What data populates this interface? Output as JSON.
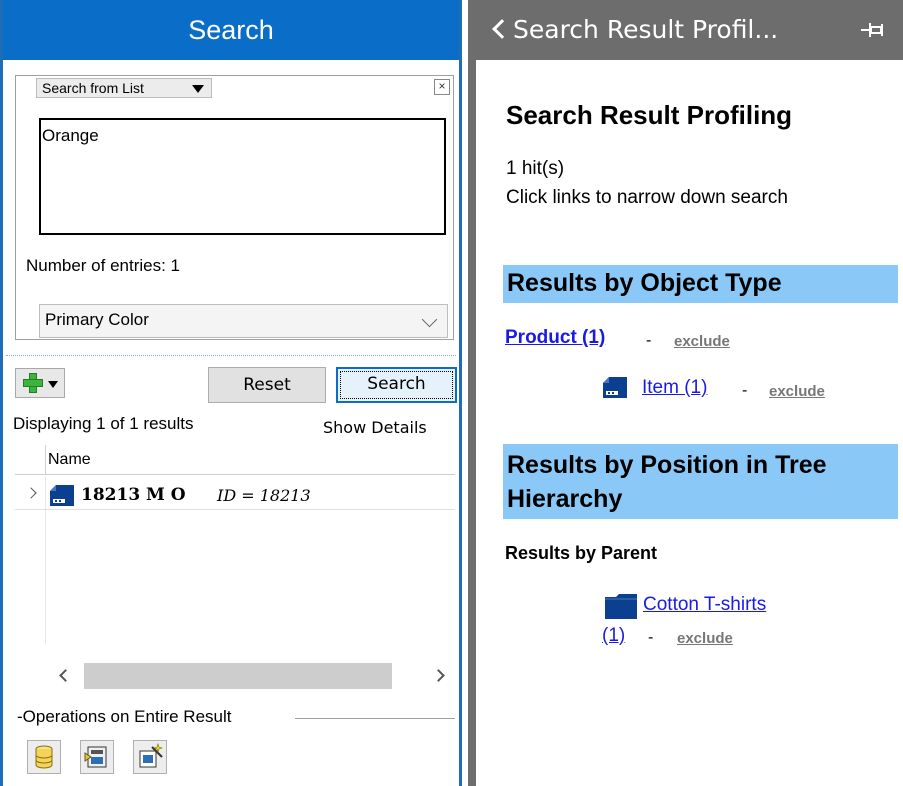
{
  "left_panel": {
    "title": "Search",
    "search_mode": "Search from List",
    "group_close": "×",
    "list_value": "Orange",
    "entries_label": "Number of entries: 1",
    "attribute_select": "Primary Color",
    "reset_label": "Reset",
    "search_label": "Search",
    "displaying": "Displaying 1 of 1 results",
    "show_details": "Show Details",
    "grid": {
      "column_name": "Name",
      "rows": [
        {
          "id": "18213 M O",
          "attr": "ID = 18213"
        }
      ]
    },
    "operations_label": "-Operations on Entire Result"
  },
  "right_panel": {
    "header": "Search Result Profil...",
    "title": "Search Result Profiling",
    "hits": "1 hit(s)",
    "hint": "Click links to narrow down search",
    "section_object_type": "Results by Object Type",
    "product_link": "Product (1)",
    "item_link": "Item (1)",
    "section_position": "Results by Position in Tree Hierarchy",
    "by_parent": "Results by Parent",
    "cotton_link": "Cotton T-shirts",
    "cotton_count": "(1)",
    "dash": "-",
    "exclude": "exclude"
  },
  "icons": {
    "add": "plus-icon",
    "item": "item-icon",
    "folder": "folder-icon",
    "pin": "pin-icon",
    "back": "chevron-left-icon",
    "ops": [
      "database-icon",
      "export-icon",
      "wand-icon"
    ]
  },
  "colors": {
    "left_header": "#0a6ec8",
    "right_header": "#6d6d6d",
    "section_band": "#8ac8f8",
    "link": "#1a1ae6"
  }
}
